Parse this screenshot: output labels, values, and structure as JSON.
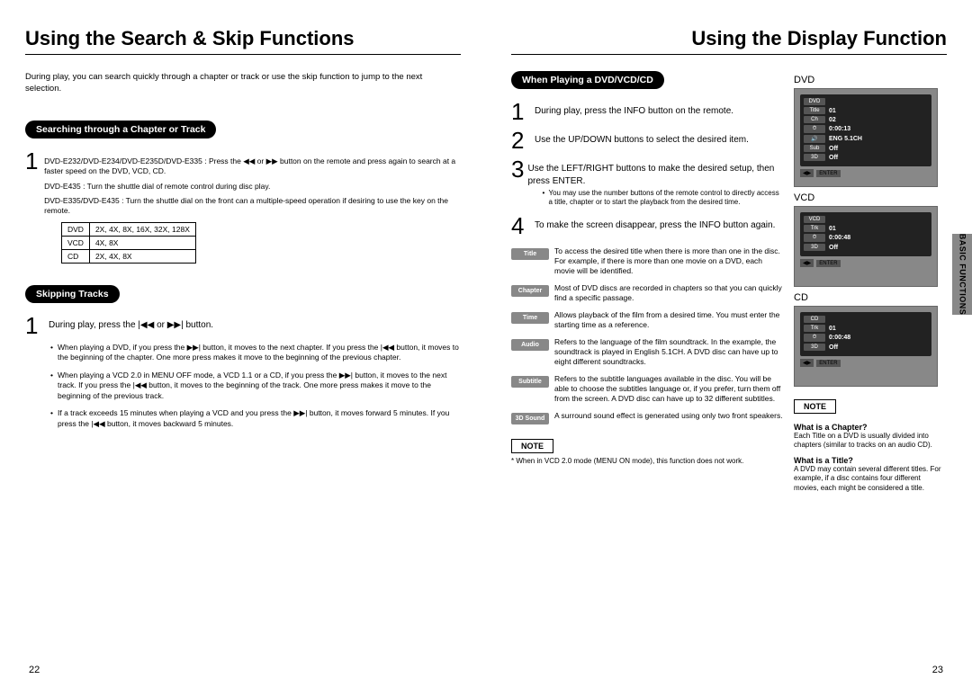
{
  "left": {
    "title": "Using the Search & Skip Functions",
    "intro": "During play, you can search quickly through a chapter or track or use the skip function to jump to the next selection.",
    "pill1": "Searching through a Chapter or Track",
    "step1a": "DVD-E232/DVD-E234/DVD-E235D/DVD-E335 : Press the ◀◀ or ▶▶ button on the remote and press again to search at a faster speed on the DVD, VCD, CD.",
    "step1b": "DVD-E435 : Turn the shuttle dial of remote control during disc play.",
    "step1c": "DVD-E335/DVD-E435 : Turn the shuttle dial on the front can a multiple-speed operation if desiring to use the key on the remote.",
    "table": {
      "r1c1": "DVD",
      "r1c2": "2X, 4X, 8X, 16X, 32X, 128X",
      "r2c1": "VCD",
      "r2c2": "4X, 8X",
      "r3c1": "CD",
      "r3c2": "2X, 4X, 8X"
    },
    "pill2": "Skipping Tracks",
    "skip1": "During play, press the |◀◀ or ▶▶| button.",
    "b1": "When playing a DVD, if you press the ▶▶| button, it moves to the next chapter. If you press the |◀◀ button, it moves to the beginning of the chapter. One more press makes it move to the beginning of the previous chapter.",
    "b2": "When playing a VCD 2.0 in MENU OFF mode, a VCD 1.1 or a CD, if you press the ▶▶| button, it moves to the next track. If you press the |◀◀ button, it moves to the beginning of the track. One more press makes it move to the beginning of the previous track.",
    "b3": "If a track exceeds 15 minutes when playing a VCD and you press the ▶▶| button, it moves forward 5 minutes. If you press the |◀◀ button, it moves backward 5 minutes.",
    "pagenum": "22"
  },
  "right": {
    "title": "Using the Display Function",
    "pill1": "When Playing a DVD/VCD/CD",
    "s1": "During play, press the INFO button on the remote.",
    "s2": "Use the UP/DOWN buttons to select the desired item.",
    "s3": "Use the LEFT/RIGHT buttons to make the desired setup, then press ENTER.",
    "s3_bullets": {
      "a": "You may use the number buttons of the remote control to directly access a title, chapter or to start the playback from the desired time."
    },
    "s4": "To make the screen disappear, press the INFO button again.",
    "info": {
      "title_l": "Title",
      "title_d": "To access the desired title when there is more than one in the disc. For example, if there is more than one movie on a DVD, each movie will be identified.",
      "chapter_l": "Chapter",
      "chapter_d": "Most of DVD discs are recorded in chapters so that you can quickly find a specific passage.",
      "time_l": "Time",
      "time_d": "Allows playback of the film from a desired time. You must enter the starting time as a reference.",
      "audio_l": "Audio",
      "audio_d": "Refers to the language of the film soundtrack. In the example, the soundtrack is played in English 5.1CH. A DVD disc can have up to eight different soundtracks.",
      "subtitle_l": "Subtitle",
      "subtitle_d": "Refers to the subtitle languages available in the disc. You will be able to choose the subtitles language or, if you prefer, turn them off from the screen. A DVD disc can have up to 32 different subtitles.",
      "sound_l": "3D Sound",
      "sound_d": "A surround sound effect is generated using only two front speakers."
    },
    "note_label": "NOTE",
    "note_text": "* When in VCD 2.0 mode (MENU ON mode), this function does not work.",
    "side": {
      "dvd": "DVD",
      "vcd": "VCD",
      "cd": "CD",
      "osd_dvd": {
        "tag": "DVD",
        "title": "01",
        "chapter": "02",
        "time": "0:00:13",
        "audio": "ENG 5.1CH",
        "sub": "Off",
        "sound": "Off"
      },
      "osd_vcd": {
        "tag": "VCD",
        "title": "01",
        "time": "0:00:48",
        "sound": "Off"
      },
      "osd_cd": {
        "tag": "CD",
        "title": "01",
        "time": "0:00:48",
        "sound": "Off"
      },
      "note_label": "NOTE",
      "q1h": "What is a Chapter?",
      "q1t": "Each Title on a DVD is usually divided into chapters (similar to tracks on an audio CD).",
      "q2h": "What is a Title?",
      "q2t": "A DVD may contain several different titles. For example, if a disc contains four different movies, each might be considered a title."
    },
    "sidetab": "BASIC FUNCTIONS",
    "pagenum": "23"
  }
}
